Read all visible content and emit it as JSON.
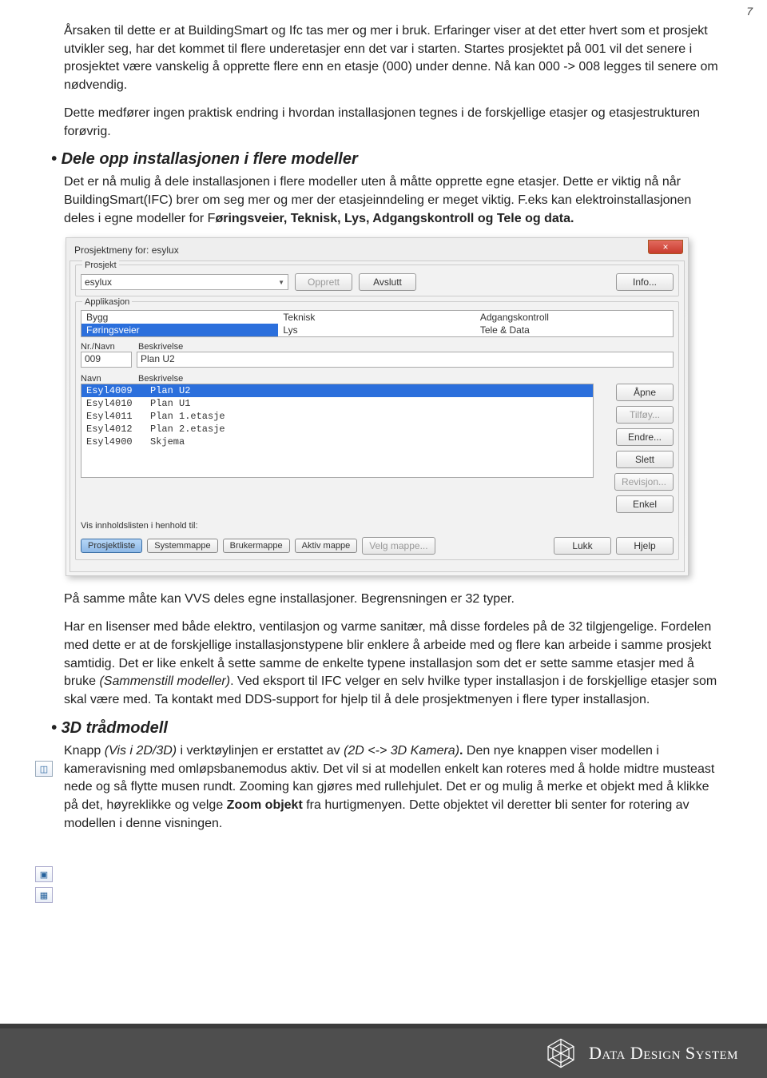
{
  "page_number": "7",
  "para1": "Årsaken til dette er at BuildingSmart og Ifc tas mer og mer i bruk. Erfaringer viser at det etter hvert som et prosjekt utvikler seg, har det kommet til flere underetasjer enn det var i starten. Startes prosjektet på 001 vil det senere i prosjektet være vanskelig å opprette flere enn en etasje (000) under denne. Nå kan 000 -> 008 legges til senere om nødvendig.",
  "para2": "Dette medfører ingen praktisk endring i hvordan installasjonen tegnes i de forskjellige etasjer og etasjestrukturen forøvrig.",
  "sec1_title": "Dele opp installasjonen i flere modeller",
  "sec1_intro_a": "Det er nå mulig å dele installasjonen i flere modeller uten å måtte opprette egne etasjer. Dette er viktig nå når BuildingSmart(IFC) brer om seg mer og mer der etasjeinndeling er meget viktig. F.eks kan elektroinstallasjonen deles i egne modeller for F",
  "sec1_intro_b": "øringsveier, Teknisk, Lys, Adgangskontroll og Tele og data.",
  "dlg": {
    "title": "Prosjektmeny for: esylux",
    "close": "×",
    "grp_prosjekt": "Prosjekt",
    "combo_value": "esylux",
    "btn_opprett": "Opprett",
    "btn_avslutt": "Avslutt",
    "btn_info": "Info...",
    "grp_app": "Applikasjon",
    "apps": {
      "c1a": "Bygg",
      "c1b": "Føringsveier",
      "c2a": "Teknisk",
      "c2b": "Lys",
      "c3a": "Adgangskontroll",
      "c3b": "Tele & Data"
    },
    "hdr_nr": "Nr./Navn",
    "hdr_besk": "Beskrivelse",
    "nr_value": "009",
    "besk_value": "Plan U2",
    "hdr2_navn": "Navn",
    "hdr2_besk": "Beskrivelse",
    "files": [
      {
        "n": "Esyl4009",
        "b": "Plan U2"
      },
      {
        "n": "Esyl4010",
        "b": "Plan U1"
      },
      {
        "n": "Esyl4011",
        "b": "Plan 1.etasje"
      },
      {
        "n": "Esyl4012",
        "b": "Plan 2.etasje"
      },
      {
        "n": "Esyl4900",
        "b": "Skjema"
      }
    ],
    "btn_apne": "Åpne",
    "btn_tilfoy": "Tilføy...",
    "btn_endre": "Endre...",
    "btn_slett": "Slett",
    "btn_revisjon": "Revisjon...",
    "btn_enkel": "Enkel",
    "vis_label": "Vis innholdslisten i henhold til:",
    "tgl_prosjektliste": "Prosjektliste",
    "tgl_systemmappe": "Systemmappe",
    "tgl_brukermappe": "Brukermappe",
    "tgl_aktivmappe": "Aktiv mappe",
    "btn_velgmappe": "Velg mappe...",
    "btn_lukk": "Lukk",
    "btn_hjelp": "Hjelp"
  },
  "para_after1": "På samme måte kan VVS deles egne installasjoner. Begrensningen er 32 typer.",
  "para_after2_a": "Har en lisenser med både elektro, ventilasjon og varme sanitær, må disse fordeles på de 32 tilgjengelige.  Fordelen med dette er at de forskjellige installasjonstypene blir enklere å arbeide med og flere kan arbeide i samme prosjekt samtidig. Det er like enkelt å sette samme de enkelte typene installasjon som det er sette samme etasjer med å bruke ",
  "para_after2_em": "(Sammenstill modeller)",
  "para_after2_b": ".  Ved eksport til IFC velger en selv hvilke typer installasjon i de forskjellige etasjer som skal være med.  Ta kontakt med DDS-support for hjelp til å dele prosjektmenyen i flere typer installasjon.",
  "sec2_title": "3D trådmodell",
  "sec2_a": "Knapp ",
  "sec2_em1": "(Vis i 2D/3D)",
  "sec2_b": " i verktøylinjen er erstattet av ",
  "sec2_em2": "(2D <-> 3D Kamera)",
  "sec2_bold_dot": ". ",
  "sec2_c": "Den nye knappen viser modellen i kameravisning med omløpsbanemodus aktiv. Det vil si at modellen enkelt kan roteres med å holde midtre musteast nede og så flytte musen rundt. Zooming kan gjøres med rullehjulet. Det er og mulig å merke et objekt med å klikke på det, høyreklikke og velge ",
  "sec2_bold": "Zoom objekt",
  "sec2_d": " fra hurtigmenyen. Dette objektet vil deretter bli senter for rotering av modellen i denne visningen.",
  "footer_brand": "Data Design System"
}
